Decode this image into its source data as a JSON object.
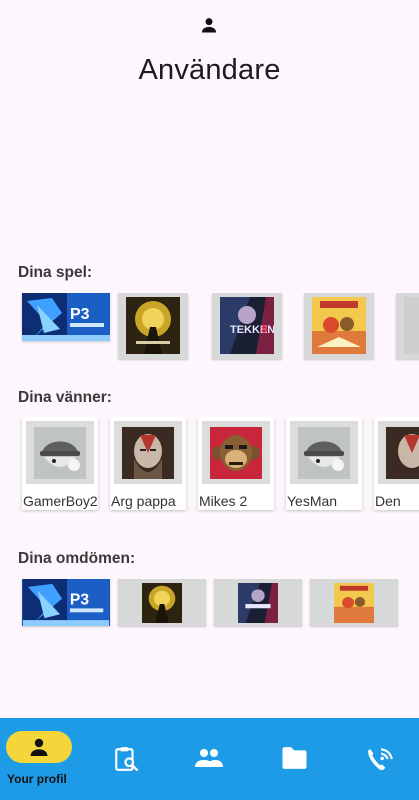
{
  "header": {
    "title": "Användare",
    "icon": "person-icon"
  },
  "games_section": {
    "title": "Dina spel:",
    "games": [
      {
        "id": "persona3",
        "icon": "persona3-cover"
      },
      {
        "id": "darksouls3",
        "icon": "darksouls3-cover"
      },
      {
        "id": "tekken8",
        "icon": "tekken8-cover"
      },
      {
        "id": "ittakestwo",
        "icon": "ittakestwo-cover"
      },
      {
        "id": "partial",
        "icon": "game-cover"
      }
    ]
  },
  "friends_section": {
    "title": "Dina vänner:",
    "friends": [
      {
        "name": "GamerBoy2",
        "avatar": "robber-avatar"
      },
      {
        "name": "Arg pappa",
        "avatar": "kratos-avatar"
      },
      {
        "name": "Mikes 2",
        "avatar": "monkey-avatar"
      },
      {
        "name": "YesMan",
        "avatar": "robber-avatar"
      },
      {
        "name": "Den",
        "avatar": "kratos-avatar"
      }
    ]
  },
  "reviews_section": {
    "title": "Dina omdömen:",
    "reviews": [
      {
        "id": "persona3",
        "icon": "persona3-cover"
      },
      {
        "id": "darksouls3",
        "icon": "darksouls3-cover"
      },
      {
        "id": "tekken8",
        "icon": "tekken8-cover"
      },
      {
        "id": "ittakestwo",
        "icon": "ittakestwo-cover"
      }
    ]
  },
  "nav": {
    "items": [
      {
        "label": "Your profil",
        "icon": "person-icon",
        "active": true
      },
      {
        "icon": "clipboard-search-icon"
      },
      {
        "icon": "group-icon"
      },
      {
        "icon": "folder-icon"
      },
      {
        "icon": "wifi-call-icon"
      }
    ]
  },
  "colors": {
    "nav_bg": "#1e9be6",
    "active_pill": "#f5d63a",
    "background": "#fdf6fd"
  }
}
